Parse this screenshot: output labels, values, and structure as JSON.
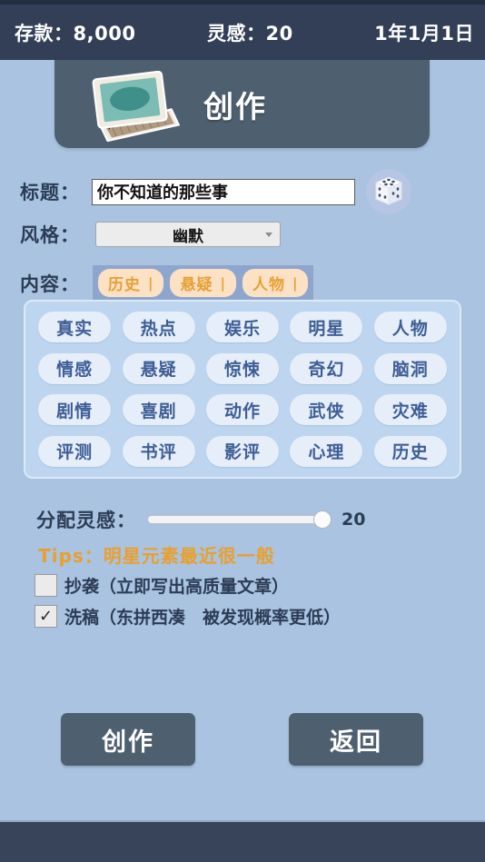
{
  "statusbar": {
    "money": "存款：8,000",
    "inspiration": "灵感：20",
    "date": "1年1月1日"
  },
  "header": {
    "title": "创作",
    "icon": "laptop-icon"
  },
  "form": {
    "title_label": "标题：",
    "title_value": "你不知道的那些事",
    "title_placeholder": "",
    "dice_icon": "dice-icon",
    "style_label": "风格：",
    "style_value": "幽默",
    "style_options": [
      "幽默"
    ],
    "content_label": "内容：",
    "selected_tags": [
      {
        "label": "历史",
        "remove": "|"
      },
      {
        "label": "悬疑",
        "remove": "|"
      },
      {
        "label": "人物",
        "remove": "|"
      }
    ],
    "tag_rows": [
      [
        "真实",
        "热点",
        "娱乐",
        "明星",
        "人物"
      ],
      [
        "情感",
        "悬疑",
        "惊悚",
        "奇幻",
        "脑洞"
      ],
      [
        "剧情",
        "喜剧",
        "动作",
        "武侠",
        "灾难"
      ],
      [
        "评测",
        "书评",
        "影评",
        "心理",
        "历史"
      ]
    ],
    "slider_label": "分配灵感：",
    "slider_value": "20",
    "slider_percent": 100,
    "tips": "Tips：明星元素最近很一般",
    "checkbox_plagiarize": {
      "label": "抄袭（立即写出高质量文章）",
      "checked": false,
      "mark": ""
    },
    "checkbox_rewrite": {
      "label": "洗稿（东拼西凑　被发现概率更低）",
      "checked": true,
      "mark": "✓"
    }
  },
  "buttons": {
    "create": "创作",
    "back": "返回"
  },
  "colors": {
    "background": "#a9c3e0",
    "statusbar": "#323f56",
    "panel": "#4e6070",
    "accent_orange": "#e8a02f",
    "tag_chip": "#e6eefa",
    "tag_text": "#3e5e95",
    "selected_tag_bg": "#fde1c4"
  }
}
